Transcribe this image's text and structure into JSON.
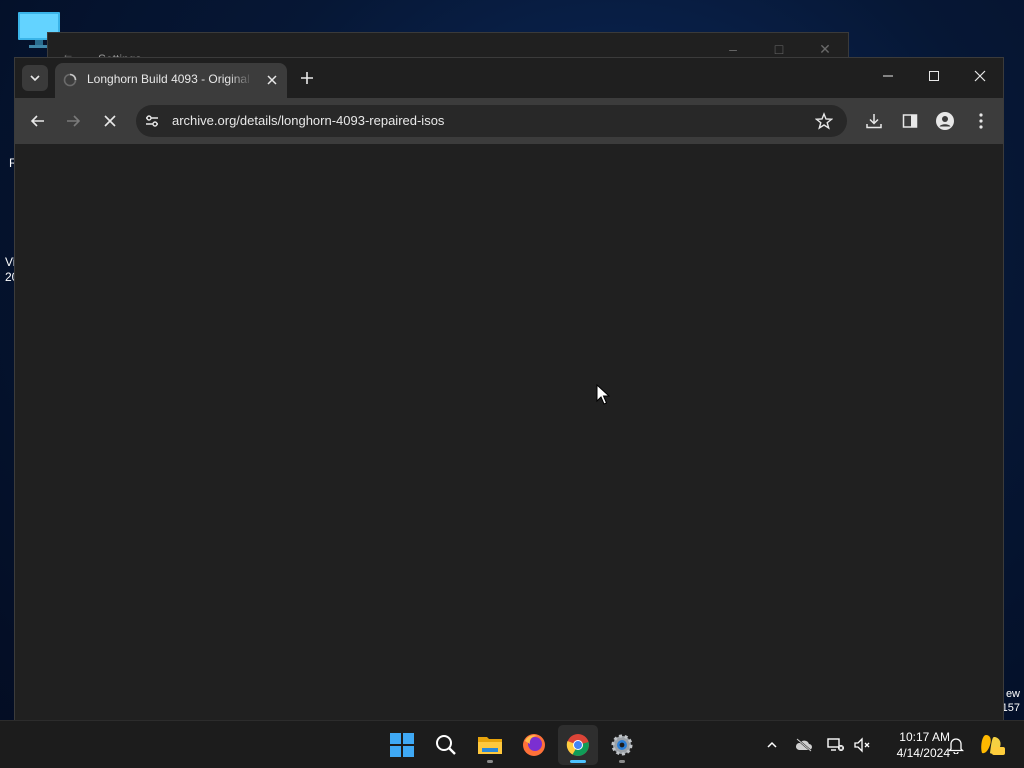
{
  "desktop": {
    "fragment_left_1": "R",
    "fragment_left_2a": "Vi",
    "fragment_left_2b": "20",
    "fragment_right_a": "ew",
    "fragment_right_b": "157"
  },
  "settings_window": {
    "title": "Settings"
  },
  "browser": {
    "tab": {
      "title": "Longhorn Build 4093 - Original",
      "state": "loading"
    },
    "omnibox": {
      "url": "archive.org/details/longhorn-4093-repaired-isos"
    },
    "colors": {
      "frame": "#1f1f1f",
      "toolbar": "#3c3c3c",
      "content": "#202020",
      "accent": "#4cc2ff"
    }
  },
  "taskbar": {
    "apps": [
      {
        "name": "Start",
        "icon": "windows-logo-icon"
      },
      {
        "name": "Search",
        "icon": "search-icon"
      },
      {
        "name": "File Explorer",
        "icon": "folder-icon"
      },
      {
        "name": "Firefox",
        "icon": "firefox-icon"
      },
      {
        "name": "Chrome",
        "icon": "chrome-icon",
        "active": true
      },
      {
        "name": "Settings",
        "icon": "gear-icon"
      }
    ],
    "clock": {
      "time": "10:17 AM",
      "date": "4/14/2024"
    }
  }
}
